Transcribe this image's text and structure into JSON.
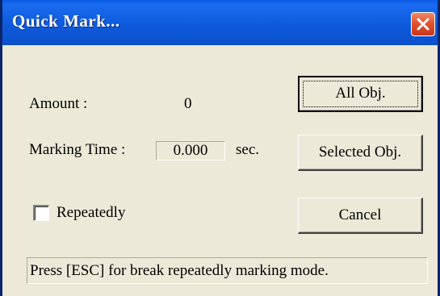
{
  "window": {
    "title": "Quick Mark..."
  },
  "amount": {
    "label": "Amount :",
    "value": "0"
  },
  "marking_time": {
    "label": "Marking Time :",
    "value": "0.000",
    "unit": "sec."
  },
  "repeatedly": {
    "label": "Repeatedly",
    "checked": false
  },
  "buttons": {
    "all_obj": "All Obj.",
    "selected_obj": "Selected Obj.",
    "cancel": "Cancel"
  },
  "status": {
    "text": "Press [ESC] for break repeatedly marking mode."
  },
  "colors": {
    "titlebar": "#0B50CC",
    "close_button": "#E2532F",
    "dialog_background": "#ECE9D8"
  }
}
